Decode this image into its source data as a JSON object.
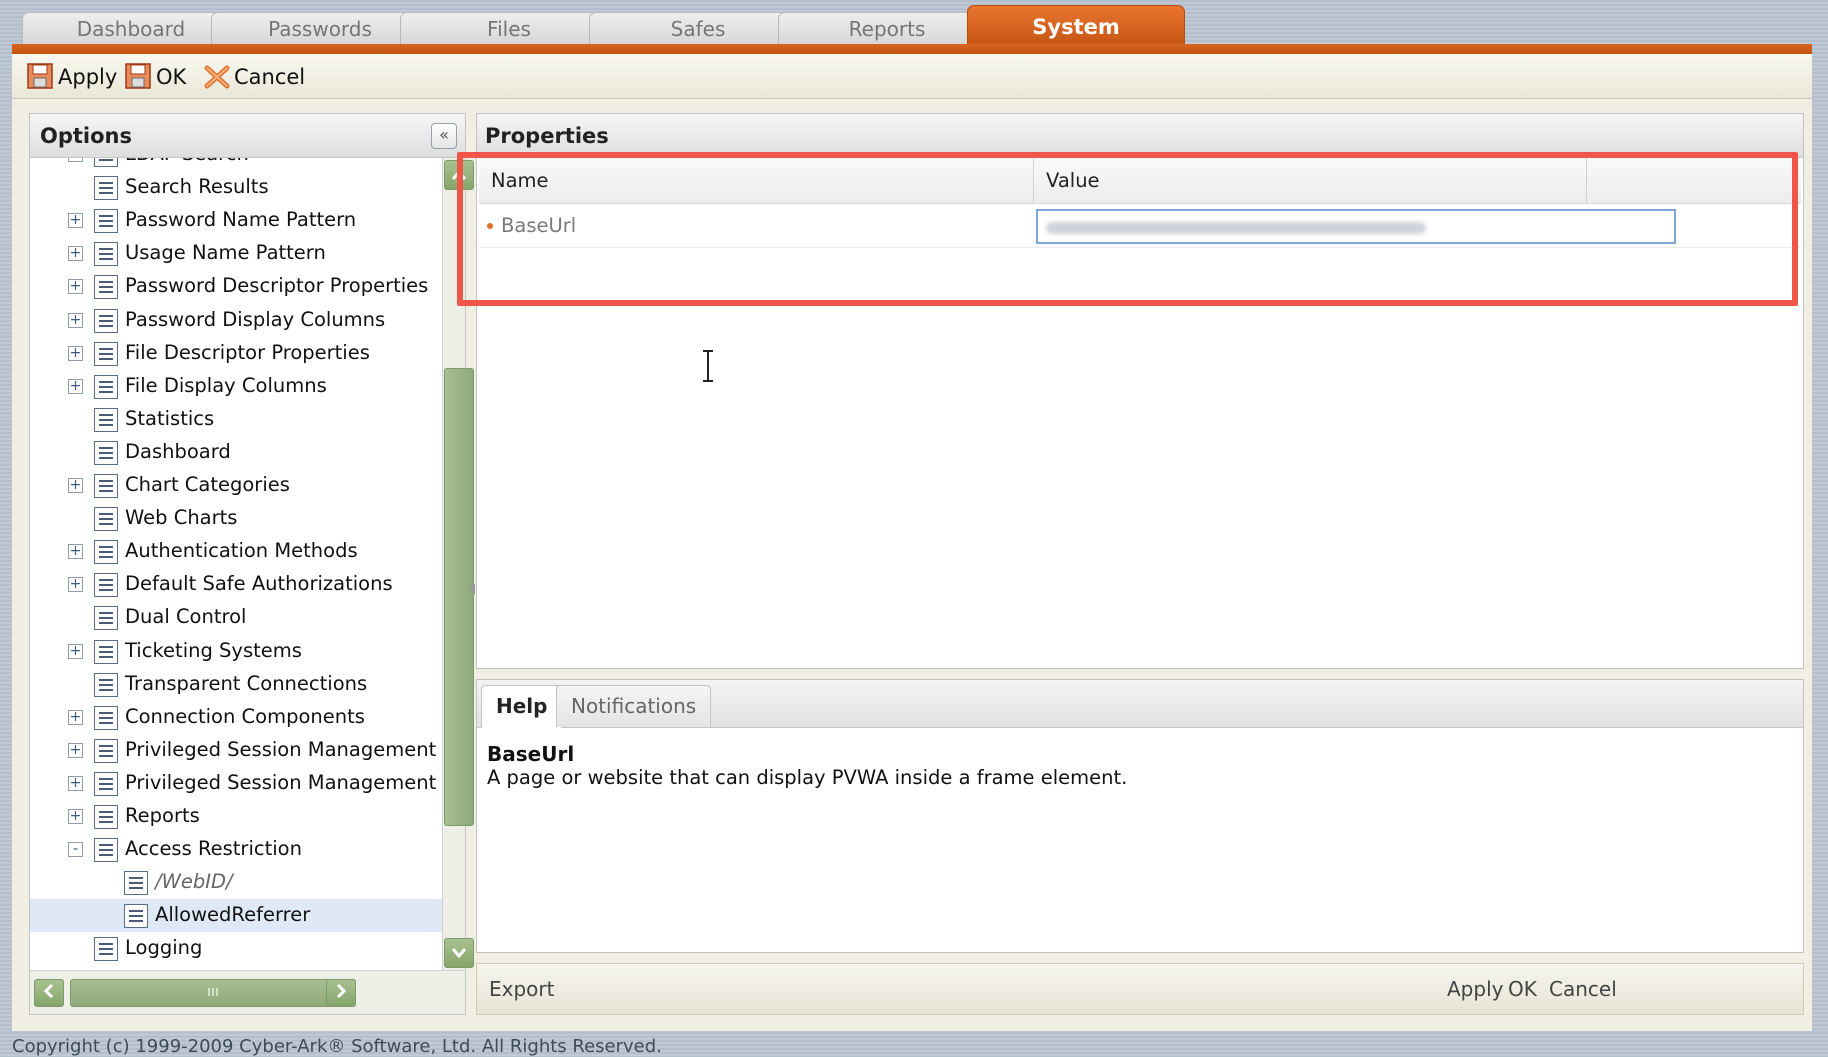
{
  "tabs": [
    {
      "label": "Dashboard",
      "active": false
    },
    {
      "label": "Passwords",
      "active": false
    },
    {
      "label": "Files",
      "active": false
    },
    {
      "label": "Safes",
      "active": false
    },
    {
      "label": "Reports",
      "active": false
    },
    {
      "label": "System",
      "active": true
    }
  ],
  "toolbar": {
    "apply": "Apply",
    "ok": "OK",
    "cancel": "Cancel"
  },
  "options": {
    "title": "Options",
    "collapse_glyph": "«",
    "items": [
      {
        "label": "LDAP Search",
        "toggle": "+",
        "indent": 0
      },
      {
        "label": "Search Results",
        "toggle": "",
        "indent": 0
      },
      {
        "label": "Password Name Pattern",
        "toggle": "+",
        "indent": 0
      },
      {
        "label": "Usage Name Pattern",
        "toggle": "+",
        "indent": 0
      },
      {
        "label": "Password Descriptor Properties",
        "toggle": "+",
        "indent": 0
      },
      {
        "label": "Password Display Columns",
        "toggle": "+",
        "indent": 0
      },
      {
        "label": "File Descriptor Properties",
        "toggle": "+",
        "indent": 0
      },
      {
        "label": "File Display Columns",
        "toggle": "+",
        "indent": 0
      },
      {
        "label": "Statistics",
        "toggle": "",
        "indent": 0
      },
      {
        "label": "Dashboard",
        "toggle": "",
        "indent": 0
      },
      {
        "label": "Chart Categories",
        "toggle": "+",
        "indent": 0
      },
      {
        "label": "Web Charts",
        "toggle": "",
        "indent": 0
      },
      {
        "label": "Authentication Methods",
        "toggle": "+",
        "indent": 0
      },
      {
        "label": "Default Safe Authorizations",
        "toggle": "+",
        "indent": 0
      },
      {
        "label": "Dual Control",
        "toggle": "",
        "indent": 0
      },
      {
        "label": "Ticketing Systems",
        "toggle": "+",
        "indent": 0
      },
      {
        "label": "Transparent Connections",
        "toggle": "",
        "indent": 0
      },
      {
        "label": "Connection Components",
        "toggle": "+",
        "indent": 0
      },
      {
        "label": "Privileged Session Management I",
        "toggle": "+",
        "indent": 0
      },
      {
        "label": "Privileged Session Management",
        "toggle": "+",
        "indent": 0
      },
      {
        "label": "Reports",
        "toggle": "+",
        "indent": 0
      },
      {
        "label": "Access Restriction",
        "toggle": "-",
        "indent": 0
      },
      {
        "label": "/WebID/",
        "toggle": "",
        "indent": 1,
        "italic": true
      },
      {
        "label": "AllowedReferrer",
        "toggle": "",
        "indent": 1,
        "selected": true
      },
      {
        "label": "Logging",
        "toggle": "",
        "indent": 0
      }
    ]
  },
  "properties": {
    "title": "Properties",
    "columns": {
      "name": "Name",
      "value": "Value"
    },
    "rows": [
      {
        "name": "BaseUrl",
        "value": ""
      }
    ]
  },
  "help": {
    "tabs": [
      {
        "label": "Help",
        "active": true
      },
      {
        "label": "Notifications",
        "active": false
      }
    ],
    "title": "BaseUrl",
    "text": "A page or website that can display PVWA inside a frame element."
  },
  "bottom": {
    "export": "Export",
    "apply": "Apply",
    "ok": "OK",
    "cancel": "Cancel"
  },
  "footer": {
    "copyright": "Copyright (c) 1999-2009 Cyber-Ark® Software, Ltd. All Rights Reserved."
  },
  "colors": {
    "accent": "#d86520",
    "highlight": "#f0554a",
    "selection": "#dfe9f6"
  }
}
